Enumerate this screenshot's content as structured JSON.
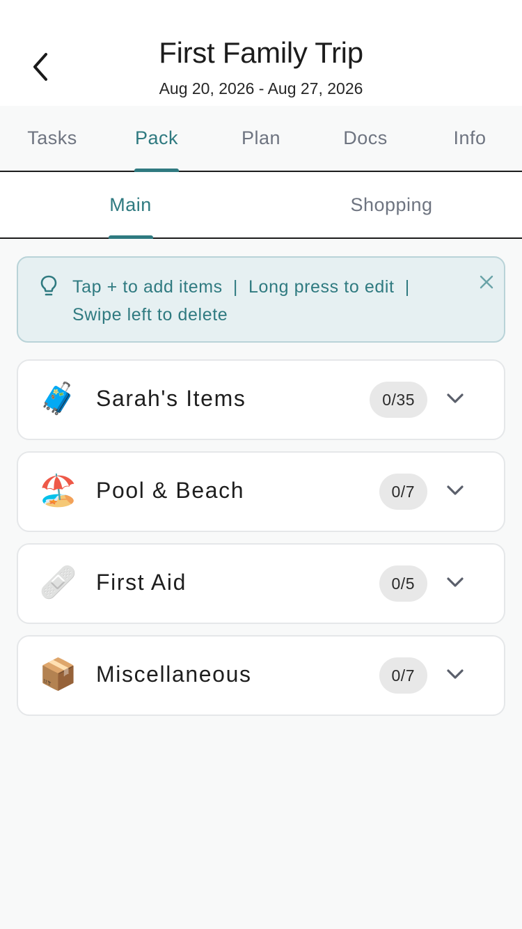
{
  "header": {
    "title": "First Family Trip",
    "dates": "Aug 20, 2026 - Aug 27, 2026"
  },
  "tabs": [
    {
      "label": "Tasks",
      "active": false
    },
    {
      "label": "Pack",
      "active": true
    },
    {
      "label": "Plan",
      "active": false
    },
    {
      "label": "Docs",
      "active": false
    },
    {
      "label": "Info",
      "active": false
    }
  ],
  "subtabs": [
    {
      "label": "Main",
      "active": true
    },
    {
      "label": "Shopping",
      "active": false
    }
  ],
  "hint": {
    "line1": "Tap + to add items  |  Long press to edit  |",
    "line2": "Swipe left to delete"
  },
  "categories": [
    {
      "icon": "luggage-icon",
      "emoji": "🧳",
      "name": "Sarah's Items",
      "count": "0/35"
    },
    {
      "icon": "beach-icon",
      "emoji": "🏖️",
      "name": "Pool & Beach",
      "count": "0/7"
    },
    {
      "icon": "bandage-icon",
      "emoji": "🩹",
      "name": "First Aid",
      "count": "0/5"
    },
    {
      "icon": "package-icon",
      "emoji": "📦",
      "name": "Miscellaneous",
      "count": "0/7"
    }
  ],
  "colors": {
    "accent": "#2f7a80",
    "hint_bg": "#e6f0f2",
    "badge_bg": "#e8e8e8"
  }
}
